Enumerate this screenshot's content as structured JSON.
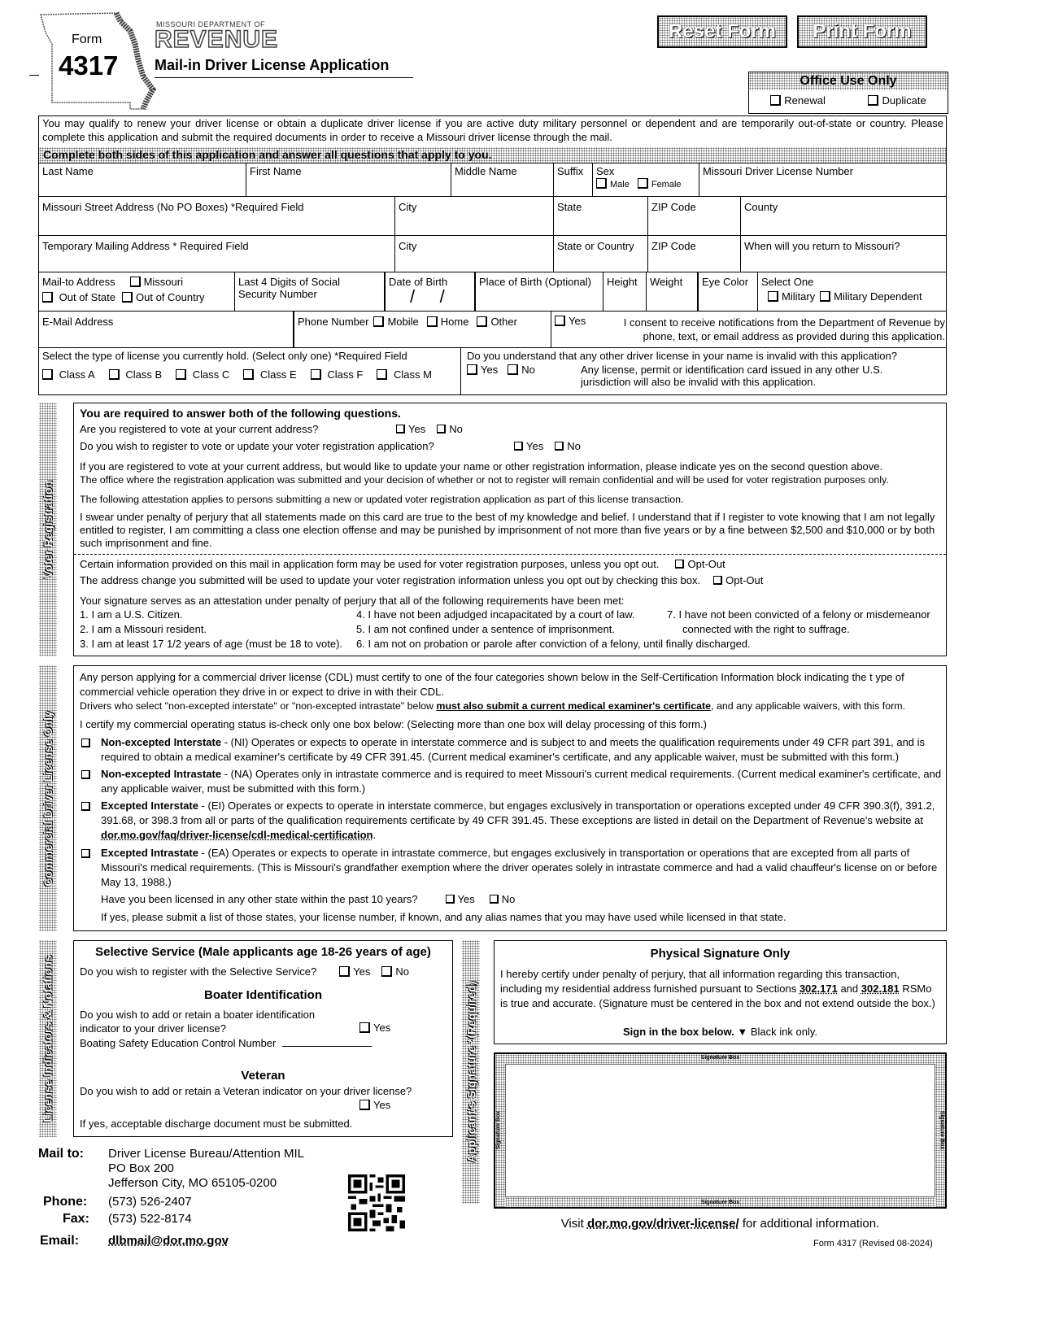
{
  "header": {
    "form_label": "Form",
    "form_number": "4317",
    "agency_small": "MISSOURI DEPARTMENT OF",
    "agency_big": "REVENUE",
    "title": "Mail-in Driver License Application",
    "reset_button": "Reset Form",
    "print_button": "Print Form"
  },
  "office_use": {
    "title": "Office Use Only",
    "options": [
      "Renewal",
      "Duplicate"
    ]
  },
  "intro": {
    "text": "You may qualify to renew your driver license or obtain a duplicate driver license if you are active duty military personnel or dependent and are temporarily out-of-state or country. Please complete this application and submit the required documents in order to receive a Missouri driver license through the mail.",
    "banner": "Complete both sides of this application and answer all questions that apply to you."
  },
  "fields": {
    "last_name": "Last Name",
    "first_name": "First Name",
    "middle_name": "Middle Name",
    "suffix": "Suffix",
    "sex": "Sex",
    "male": "Male",
    "female": "Female",
    "mo_dl_number": "Missouri Driver License Number",
    "street": "Missouri Street Address (No PO Boxes) *Required Field",
    "city": "City",
    "state": "State",
    "zip": "ZIP Code",
    "county": "County",
    "temp_addr": "Temporary Mailing Address * Required Field",
    "city2": "City",
    "state_country": "State or Country",
    "zip2": "ZIP Code",
    "return": "When will you return to Missouri?",
    "mail_to": "Mail-to Address",
    "mail_missouri": "Missouri",
    "mail_out_state": "Out of State",
    "mail_out_country": "Out of Country",
    "ssn": "Last 4 Digits of Social Security Number",
    "dob": "Date of Birth",
    "pob": "Place of Birth (Optional)",
    "height": "Height",
    "weight": "Weight",
    "eye": "Eye Color",
    "select_one": "Select One",
    "military": "Military",
    "military_dep": "Military Dependent",
    "email": "E-Mail Address",
    "phone": "Phone Number",
    "mobile": "Mobile",
    "home": "Home",
    "other": "Other",
    "consent_yes": "Yes",
    "consent_text": "I consent to receive notifications from the Department of Revenue by phone, text, or email address as provided during this application.",
    "license_type": "Select the type of license you currently hold. (Select only one) *Required Field",
    "classes": [
      "Class A",
      "Class B",
      "Class C",
      "Class E",
      "Class F",
      "Class M"
    ],
    "invalid_q": "Do you understand that any other driver license in your name is invalid with this application?",
    "yes": "Yes",
    "no": "No",
    "invalid_note": "Any license, permit or identification card issued in any other U.S. jurisdiction will also be invalid with this application."
  },
  "voter": {
    "tab": "Voter Registration",
    "heading": "You are required to answer both of the following questions.",
    "q1": "Are you registered to vote at your current address?",
    "q2": "Do you wish to register to vote or update your voter registration application?",
    "yes": "Yes",
    "no": "No",
    "p1": "If you are registered to vote at your current address, but would like to update your name or other registration information, please indicate yes on the second question above.",
    "p2": "The office where the registration application was submitted and your decision of whether or not to register will remain confidential and will be used for voter registration purposes only.",
    "p3": "The following attestation applies to persons submitting a new or updated voter registration application as part of this license transaction.",
    "p4": "I swear under penalty of perjury that all statements made on this card are true to the best of my knowledge and belief. I understand that if I register to vote knowing that I am not legally entitled to register, I am committing a class one election offense and may be punished by imprisonment of not more than five years or by a fine between $2,500 and $10,000 or by both such imprisonment and fine.",
    "opt1": "Certain information provided on this mail in application form may be used for voter registration purposes, unless you opt out.",
    "opt2": "The address change you submitted will be used to update your voter registration information unless you opt out by checking this box.",
    "opt_label": "Opt-Out",
    "attest": "Your signature serves as an attestation under penalty of perjury that all of the following requirements have been met:",
    "req": [
      "1. I am a U.S. Citizen.",
      "2. I am a Missouri resident.",
      "3. I am at least 17 1/2 years of age (must be 18 to vote).",
      "4. I have not been adjudged incapacitated by a court of law.",
      "5. I am not confined under a sentence of imprisonment.",
      "6. I am not on probation or parole after conviction of a felony, until finally discharged.",
      "7. I have not been convicted of a felony or misdemeanor",
      "connected with the right to suffrage."
    ]
  },
  "cdl": {
    "tab": "Commercial Driver License Only",
    "p1": "Any person applying for a commercial driver license (CDL) must certify to one of the four categories shown below in the Self-Certification Information block indicating the t ype of commercial vehicle operation they drive in or expect to drive in with their CDL.",
    "p2a": "Drivers who select \"non-excepted interstate\" or \"non-excepted intrastate\" below ",
    "p2b": "must also submit a current medical examiner's certificate",
    "p2c": ", and any applicable waivers, with this form.",
    "p3": "I certify my commercial operating status is-check only one box below:  (Selecting more than one box will delay processing of this form.)",
    "options": [
      {
        "name": "Non-excepted Interstate",
        "text": " - (NI) Operates or expects to operate in interstate commerce and is subject to and meets the qualification requirements under 49 CFR part 391, and is required to obtain a medical examiner's certificate by 49 CFR 391.45.  (Current medical examiner's certificate, and any applicable waiver, must be submitted with this form.)"
      },
      {
        "name": "Non-excepted Intrastate",
        "text": " - (NA) Operates only in intrastate commerce and is required to meet Missouri's current medical requirements.  (Current medical examiner's certificate, and any applicable waiver, must be submitted with this form.)"
      },
      {
        "name": "Excepted Interstate",
        "text": " - (EI) Operates or expects to operate in interstate commerce, but engages exclusively in transportation or operations excepted under 49 CFR 390.3(f), 391.2, 391.68, or 398.3 from all or parts of the qualification requirements certificate by 49 CFR 391.45.  These exceptions are listed in detail on the Department of Revenue's website at ",
        "link": "dor.mo.gov/faq/driver-license/cdl-medical-certification"
      },
      {
        "name": "Excepted Intrastate",
        "text": " - (EA) Operates or expects to operate in intrastate commerce, but engages exclusively in transportation or operations that are excepted from all parts of Missouri's medical requirements. (This is Missouri's grandfather exemption where the driver operates solely in intrastate commerce and had a valid chauffeur's license on or before May 13, 1988.)"
      }
    ],
    "q_other": "Have you been licensed in any other state within the past 10 years?",
    "yes": "Yes",
    "no": "No",
    "q_note": "If yes, please submit a list of those states, your license number, if known, and any alias names that you may have used while licensed in that state."
  },
  "indicators": {
    "tab": "License Indicators & Notations",
    "ss_title": "Selective Service (Male applicants age 18-26 years of age)",
    "ss_q": "Do you wish to register with the Selective Service?",
    "yes": "Yes",
    "no": "No",
    "boater_title": "Boater Identification",
    "boater_q": "Do you wish to add or retain a boater identification indicator to your driver license?",
    "boater_ctrl": "Boating Safety Education Control Number",
    "vet_title": "Veteran",
    "vet_q": "Do you wish to add or retain a Veteran indicator on your driver license?",
    "vet_note": "If yes, acceptable discharge document must be submitted."
  },
  "signature": {
    "tab": "Applicant's Signature *(Required)",
    "title": "Physical Signature Only",
    "text1": "I hereby certify under penalty of perjury, that all information regarding this transaction, including my residential address furnished pursuant to Sections ",
    "sec1": "302.171",
    "and": " and ",
    "sec2": "302.181",
    "text2": " RSMo is true and accurate. (Signature must be centered in the box and not extend outside the box.)",
    "sign_bold": "Sign in the box below.",
    "sign_arrow": "▼",
    "sign_rest": " Black ink only.",
    "box_label": "Signature Box"
  },
  "footer": {
    "mail_label": "Mail to:",
    "mail_lines": [
      "Driver License Bureau/Attention MIL",
      "PO Box 200",
      "Jefferson City, MO 65105-0200"
    ],
    "phone_label": "Phone:",
    "phone": "(573) 526-2407",
    "fax_label": "Fax:",
    "fax": "(573) 522-8174",
    "email_label": "Email:",
    "email": "dlbmail@dor.mo.gov",
    "visit_pre": "Visit ",
    "visit_link": "dor.mo.gov/driver-license/",
    "visit_post": " for additional information.",
    "revision": "Form 4317 (Revised 08-2024)"
  }
}
